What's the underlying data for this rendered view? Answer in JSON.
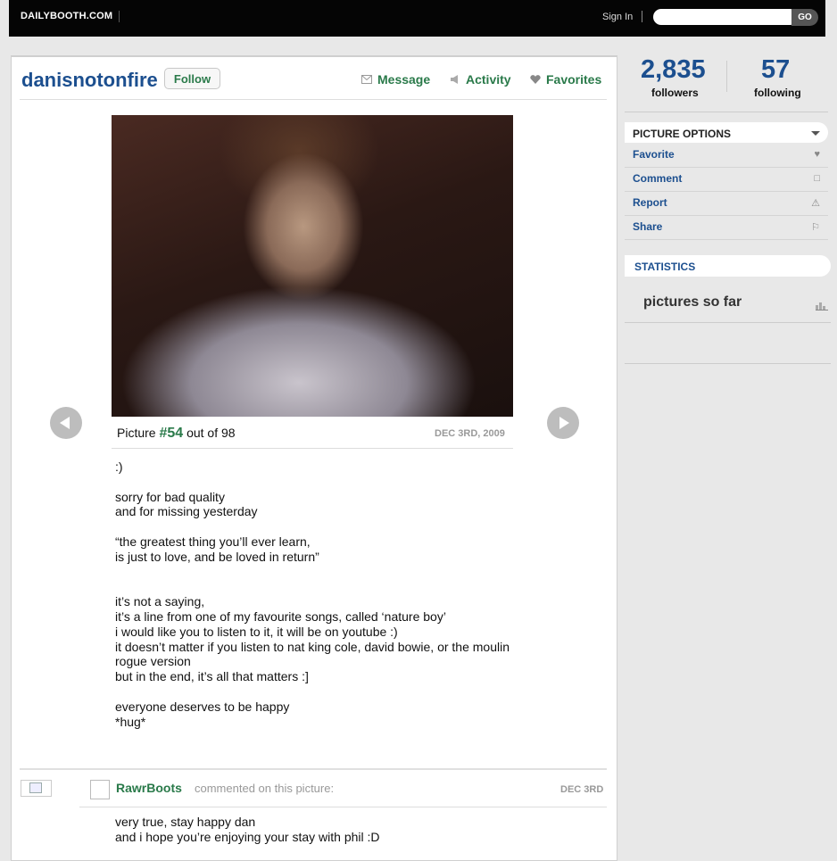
{
  "topbar": {
    "logo": "DAILYBOOTH.COM",
    "signin": "Sign In",
    "search_value": "",
    "go_label": "GO"
  },
  "profile": {
    "username": "danisnotonfire",
    "follow_label": "Follow",
    "nav": {
      "message": "Message",
      "activity": "Activity",
      "favorites": "Favorites"
    }
  },
  "picture": {
    "label_prefix": "Picture",
    "number": "#54",
    "label_suffix": "out of 98",
    "date": "DEC 3RD, 2009",
    "caption": ":)\n\nsorry for bad quality\nand for missing yesterday\n\n“the greatest thing you’ll ever learn,\nis just to love, and be loved in return”\n\n\nit’s not a saying,\nit’s a line from one of my favourite songs, called ‘nature boy’\ni would like you to listen to it, it will be on youtube :)\nit doesn’t matter if you listen to nat king cole, david bowie, or the moulin\nrogue version\nbut in the end, it’s all that matters :]\n\neveryone deserves to be happy\n*hug*"
  },
  "comment": {
    "author": "RawrBoots",
    "action": "commented on this picture:",
    "date": "DEC 3RD",
    "body": "very true, stay happy dan\nand i hope you’re enjoying your stay with phil :D"
  },
  "sidebar": {
    "followers_count": "2,835",
    "followers_label": "followers",
    "following_count": "57",
    "following_label": "following",
    "picture_options_title": "PICTURE OPTIONS",
    "options": [
      {
        "label": "Favorite",
        "icon": "heart-icon"
      },
      {
        "label": "Comment",
        "icon": "speech-bubble-icon"
      },
      {
        "label": "Report",
        "icon": "warning-icon"
      },
      {
        "label": "Share",
        "icon": "share-icon"
      }
    ],
    "statistics_title": "STATISTICS",
    "pictures_so_far": "pictures so far"
  },
  "colors": {
    "brand_blue": "#1c4f8f",
    "action_green": "#2a7a4a",
    "topbar": "#050505"
  }
}
